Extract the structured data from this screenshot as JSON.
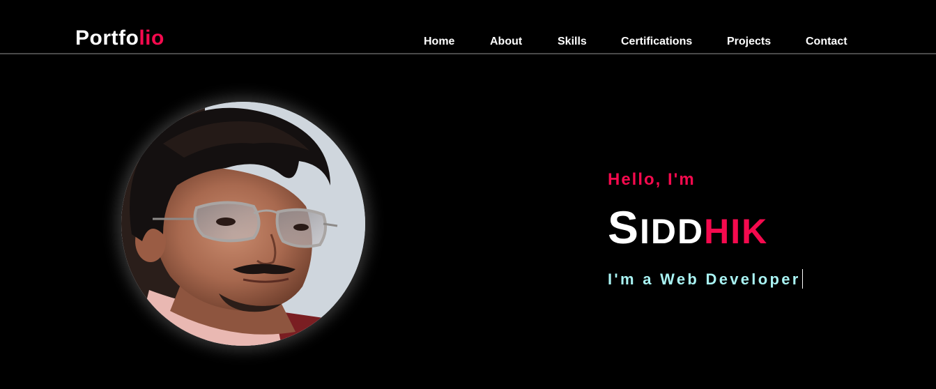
{
  "header": {
    "logo_primary": "Portfo",
    "logo_accent": "lio",
    "nav": [
      {
        "label": "Home"
      },
      {
        "label": "About"
      },
      {
        "label": "Skills"
      },
      {
        "label": "Certifications"
      },
      {
        "label": "Projects"
      },
      {
        "label": "Contact"
      }
    ]
  },
  "hero": {
    "greeting": "Hello, I'm",
    "name_first_initial": "S",
    "name_first_rest": "IDD",
    "name_last": "HIK",
    "role": "I'm a Web Developer"
  },
  "colors": {
    "background": "#000000",
    "accent": "#f50a4e",
    "role_text": "#a9f3f3",
    "nav_text": "#ffffff",
    "divider": "#4a4a4a"
  },
  "icons": {
    "profile_photo": "avatar-photo"
  }
}
